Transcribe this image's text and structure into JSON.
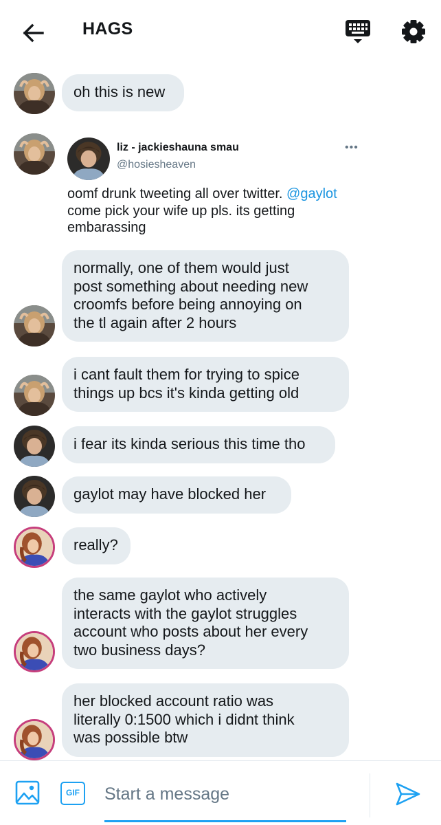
{
  "header": {
    "title": "HAGS",
    "icons": [
      "back-arrow-icon",
      "keyboard-icon",
      "gear-icon"
    ]
  },
  "messages": [
    {
      "text": "oh this is new"
    },
    {
      "shared_tweet": {
        "name": "liz - jackieshauna smau",
        "handle": "@hosiesheaven",
        "more": "•••",
        "text_before": "oomf drunk tweeting all over twitter. ",
        "mention": "@gaylot",
        "text_after": "\ncome pick your wife up pls. its getting\nembarassing"
      }
    },
    {
      "text": "normally, one of them would just\npost something about needing new\ncroomfs before being annoying on\nthe tl again after 2 hours"
    },
    {
      "text": "i cant fault them for trying to spice\nthings up bcs it's kinda getting old"
    },
    {
      "text": "i fear its kinda serious this time tho"
    },
    {
      "text": "gaylot may have blocked her"
    },
    {
      "text": "really?"
    },
    {
      "text": "the same gaylot who actively\ninteracts with the gaylot struggles\naccount who posts about her every\ntwo business days?"
    },
    {
      "text": "her blocked account ratio was\nliterally 0:1500 which i didnt think\nwas possible btw"
    }
  ],
  "composer": {
    "placeholder": "Start a message",
    "gif_label": "GIF",
    "icons": [
      "image-icon",
      "gif-icon",
      "send-icon"
    ]
  },
  "colors": {
    "accent": "#1da1f2",
    "bubble": "#e6ecf0",
    "mention": "#1b95e0",
    "secondary_text": "#657786",
    "avatar_ring": "#c63e7c"
  }
}
